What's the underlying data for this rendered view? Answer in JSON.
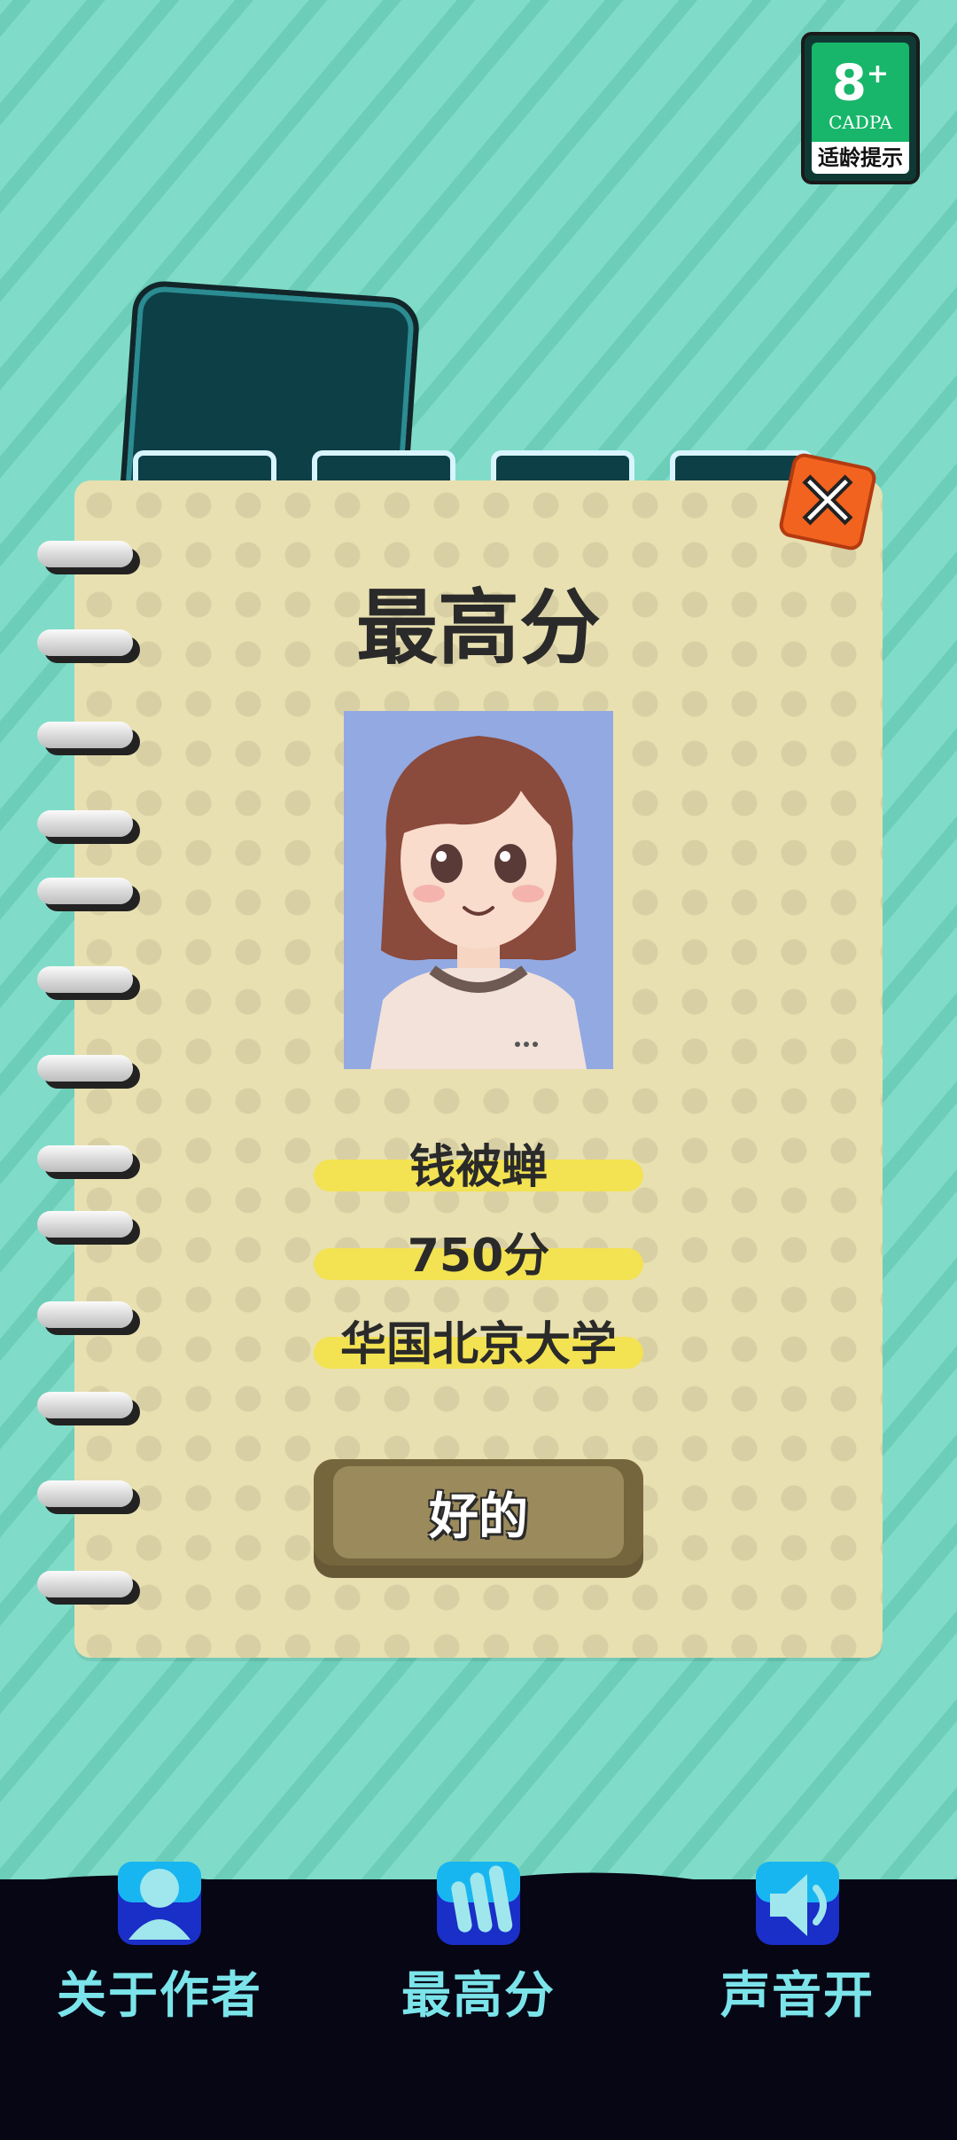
{
  "age_badge": {
    "age": "8",
    "plus": "+",
    "org": "CADPA",
    "tip": "适龄提示"
  },
  "dialog": {
    "title": "最高分",
    "name": "钱被蝉",
    "score": "750分",
    "school": "华国北京大学",
    "ok_label": "好的"
  },
  "nav": {
    "about_label": "关于作者",
    "highscore_label": "最高分",
    "sound_label": "声音开"
  },
  "colors": {
    "background": "#80dcc8",
    "paper": "#e8e0b0",
    "highlight": "#f3e252",
    "nav_text": "#7be4ea",
    "close_button": "#f1631f"
  },
  "icons": [
    "close-icon",
    "person-icon",
    "bars-icon",
    "speaker-icon",
    "portrait-image"
  ]
}
